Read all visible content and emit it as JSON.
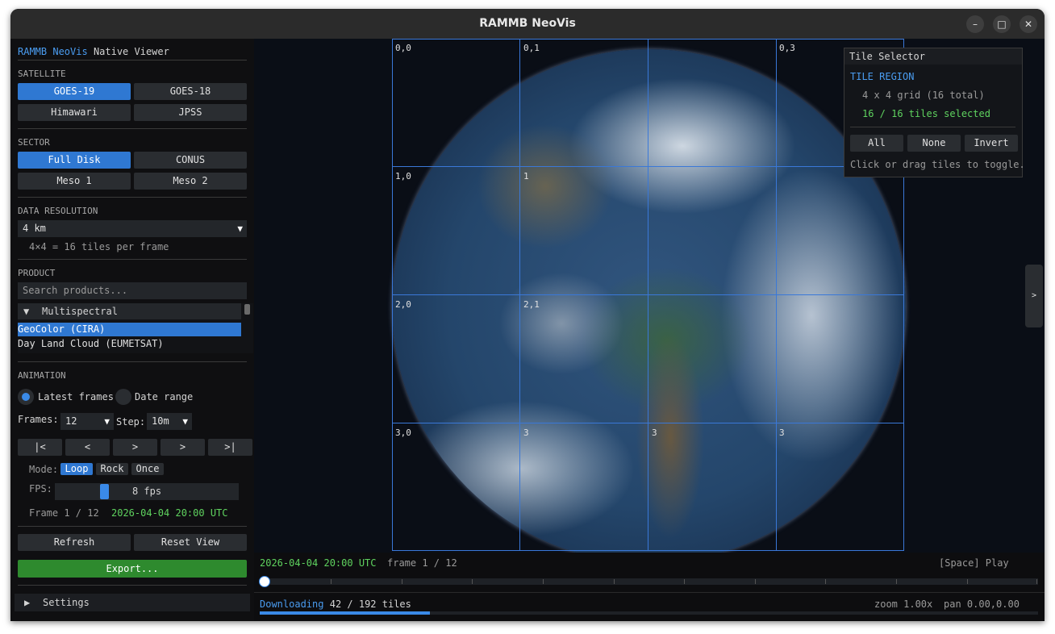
{
  "window": {
    "title": "RAMMB NeoVis",
    "minimize": "–",
    "maximize": "□",
    "close": "✕"
  },
  "sidebar": {
    "brand": "RAMMB NeoVis",
    "brand_suffix": "Native Viewer",
    "satellite": {
      "header": "SATELLITE",
      "options": [
        "GOES-19",
        "GOES-18",
        "Himawari",
        "JPSS"
      ],
      "selected": "GOES-19"
    },
    "sector": {
      "header": "SECTOR",
      "options": [
        "Full Disk",
        "CONUS",
        "Meso 1",
        "Meso 2"
      ],
      "selected": "Full Disk"
    },
    "resolution": {
      "header": "DATA RESOLUTION",
      "value": "4 km",
      "note": "4×4 = 16 tiles per frame"
    },
    "product": {
      "header": "PRODUCT",
      "search_placeholder": "Search products...",
      "group": "Multispectral",
      "items": [
        "GeoColor (CIRA)",
        "Day Land Cloud (EUMETSAT)"
      ],
      "selected": "GeoColor (CIRA)"
    },
    "animation": {
      "header": "ANIMATION",
      "radio_latest": "Latest frames",
      "radio_range": "Date range",
      "frames_label": "Frames:",
      "frames_value": "12",
      "step_label": "Step:",
      "step_value": "10m",
      "transport": [
        "|<",
        "<",
        ">",
        ">",
        ">|"
      ],
      "mode_label": "Mode:",
      "modes": [
        "Loop",
        "Rock",
        "Once"
      ],
      "mode_selected": "Loop",
      "fps_label": "FPS:",
      "fps_value": "8 fps",
      "fps_level": 0.26,
      "frame_text": "Frame 1 / 12",
      "frame_time": "2026-04-04 20:00 UTC"
    },
    "refresh": "Refresh",
    "reset_view": "Reset View",
    "export": "Export...",
    "settings": "Settings"
  },
  "viewer": {
    "tile_labels": [
      "0,0",
      "0,1",
      "0,3",
      "1,0",
      "1",
      "2,0",
      "2,1",
      "3,0",
      "3",
      "3",
      "3"
    ]
  },
  "tile_selector": {
    "title": "Tile Selector",
    "region_header": "TILE REGION",
    "grid_info": "4 x 4 grid  (16 total)",
    "selected_info": "16 / 16 tiles selected",
    "buttons": [
      "All",
      "None",
      "Invert"
    ],
    "hint": "Click or drag tiles to toggle."
  },
  "panel_toggle": ">",
  "bottom": {
    "timestamp": "2026-04-04 20:00 UTC",
    "frame": "frame 1 / 12",
    "play_hint": "[Space] Play",
    "download_label": "Downloading",
    "download_count": "42 / 192 tiles",
    "download_progress": 0.219,
    "zoom": "zoom 1.00x",
    "pan": "pan 0.00,0.00"
  },
  "colors": {
    "accent": "#2f78d2",
    "green": "#5fd35f",
    "export": "#2e8a2e"
  }
}
